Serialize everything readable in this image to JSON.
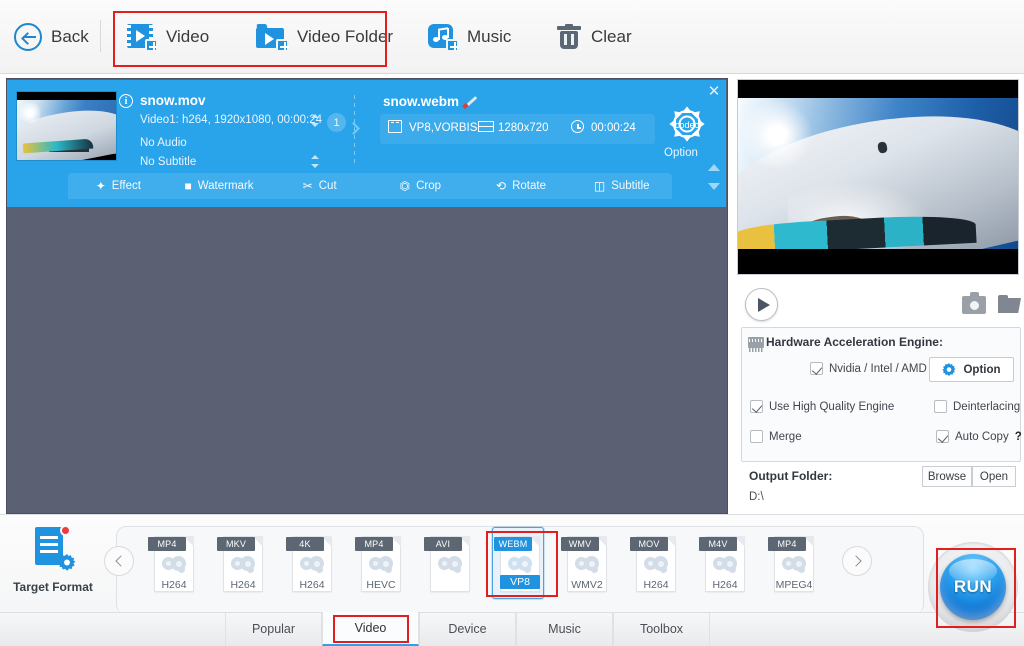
{
  "toolbar": {
    "back_label": "Back",
    "items": [
      {
        "label": "Video",
        "icon": "add-video-icon"
      },
      {
        "label": "Video Folder",
        "icon": "add-video-folder-icon"
      },
      {
        "label": "Music",
        "icon": "add-music-icon"
      },
      {
        "label": "Clear",
        "icon": "trash-icon"
      }
    ]
  },
  "file_row": {
    "source": {
      "name": "snow.mov",
      "video_track": "Video1: h264, 1920x1080, 00:00:24",
      "audio_track": "No Audio",
      "subtitle_track": "No Subtitle",
      "track_count": "1"
    },
    "output": {
      "name": "snow.webm",
      "codec": "VP8,VORBIS",
      "resolution": "1280x720",
      "duration": "00:00:24",
      "option_label": "Option",
      "option_badge": "codec"
    },
    "actions": [
      {
        "label": "Effect",
        "icon": "magic-wand-icon"
      },
      {
        "label": "Watermark",
        "icon": "stamp-icon"
      },
      {
        "label": "Cut",
        "icon": "scissors-icon"
      },
      {
        "label": "Crop",
        "icon": "crop-icon"
      },
      {
        "label": "Rotate",
        "icon": "rotate-icon"
      },
      {
        "label": "Subtitle",
        "icon": "subtitle-icon"
      }
    ],
    "close_glyph": "✕"
  },
  "preview": {
    "play_label": "play-button",
    "snapshot_label": "snapshot-icon",
    "open_folder_label": "open-folder-icon"
  },
  "hardware": {
    "title": "Hardware Acceleration Engine:",
    "nvidia": {
      "label": "Nvidia / Intel / AMD",
      "checked": true
    },
    "option_button": "Option",
    "high_quality": {
      "label": "Use High Quality Engine",
      "checked": true
    },
    "deinterlacing": {
      "label": "Deinterlacing",
      "checked": false
    },
    "merge": {
      "label": "Merge",
      "checked": false
    },
    "auto_copy": {
      "label": "Auto Copy",
      "checked": true,
      "help": "?"
    }
  },
  "output_folder": {
    "label": "Output Folder:",
    "path": "D:\\",
    "browse": "Browse",
    "open": "Open"
  },
  "target_format": {
    "label": "Target Format",
    "prev": "‹",
    "next": "›",
    "cards": [
      {
        "top": "MP4",
        "bottom": "H264",
        "selected": false
      },
      {
        "top": "MKV",
        "bottom": "H264",
        "selected": false
      },
      {
        "top": "4K",
        "bottom": "H264",
        "selected": false
      },
      {
        "top": "MP4",
        "bottom": "HEVC",
        "selected": false
      },
      {
        "top": "AVI",
        "bottom": "",
        "selected": false
      },
      {
        "top": "WEBM",
        "bottom": "VP8",
        "selected": true
      },
      {
        "top": "WMV",
        "bottom": "WMV2",
        "selected": false
      },
      {
        "top": "MOV",
        "bottom": "H264",
        "selected": false
      },
      {
        "top": "M4V",
        "bottom": "H264",
        "selected": false
      },
      {
        "top": "MP4",
        "bottom": "MPEG4",
        "selected": false
      }
    ]
  },
  "tabs": [
    {
      "label": "Popular",
      "active": false
    },
    {
      "label": "Video",
      "active": true
    },
    {
      "label": "Device",
      "active": false
    },
    {
      "label": "Music",
      "active": false
    },
    {
      "label": "Toolbox",
      "active": false
    }
  ],
  "run": {
    "label": "RUN"
  },
  "colors": {
    "accent_blue": "#1f92e0",
    "row_blue": "#29a3ea",
    "panel_gray": "#5b6072",
    "highlight_red": "#e02020",
    "tab_underline": "#2aa3ea"
  }
}
